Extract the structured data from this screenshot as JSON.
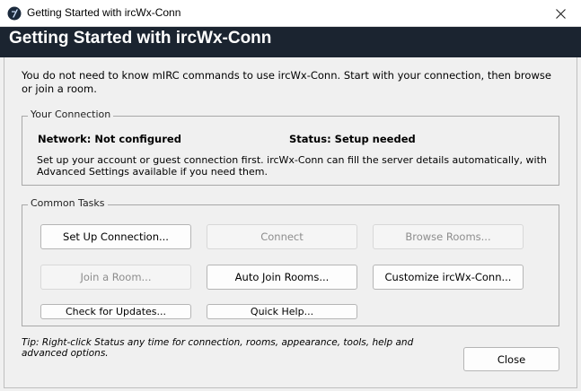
{
  "window": {
    "title": "Getting Started with ircWx-Conn",
    "icon": "app-logo-icon",
    "close_icon": "close-icon"
  },
  "header": {
    "title": "Getting Started with ircWx-Conn",
    "background": "#1b2430"
  },
  "intro": "You do not need to know mIRC commands to use ircWx-Conn. Start with your connection, then browse or join a room.",
  "connection": {
    "group_label": "Your Connection",
    "network": "Network: Not configured",
    "status": "Status: Setup needed",
    "description": "Set up your account or guest connection first. ircWx-Conn can fill the server details automatically, with Advanced Settings available if you need them."
  },
  "tasks": {
    "group_label": "Common Tasks",
    "setup": "Set Up Connection...",
    "connect": "Connect",
    "browse": "Browse Rooms...",
    "join": "Join a Room...",
    "auto_join": "Auto Join Rooms...",
    "customize": "Customize ircWx-Conn...",
    "updates": "Check for Updates...",
    "help": "Quick Help..."
  },
  "tip": "Tip: Right-click Status any time for connection, rooms, appearance, tools, help and advanced options.",
  "footer": {
    "close": "Close"
  }
}
